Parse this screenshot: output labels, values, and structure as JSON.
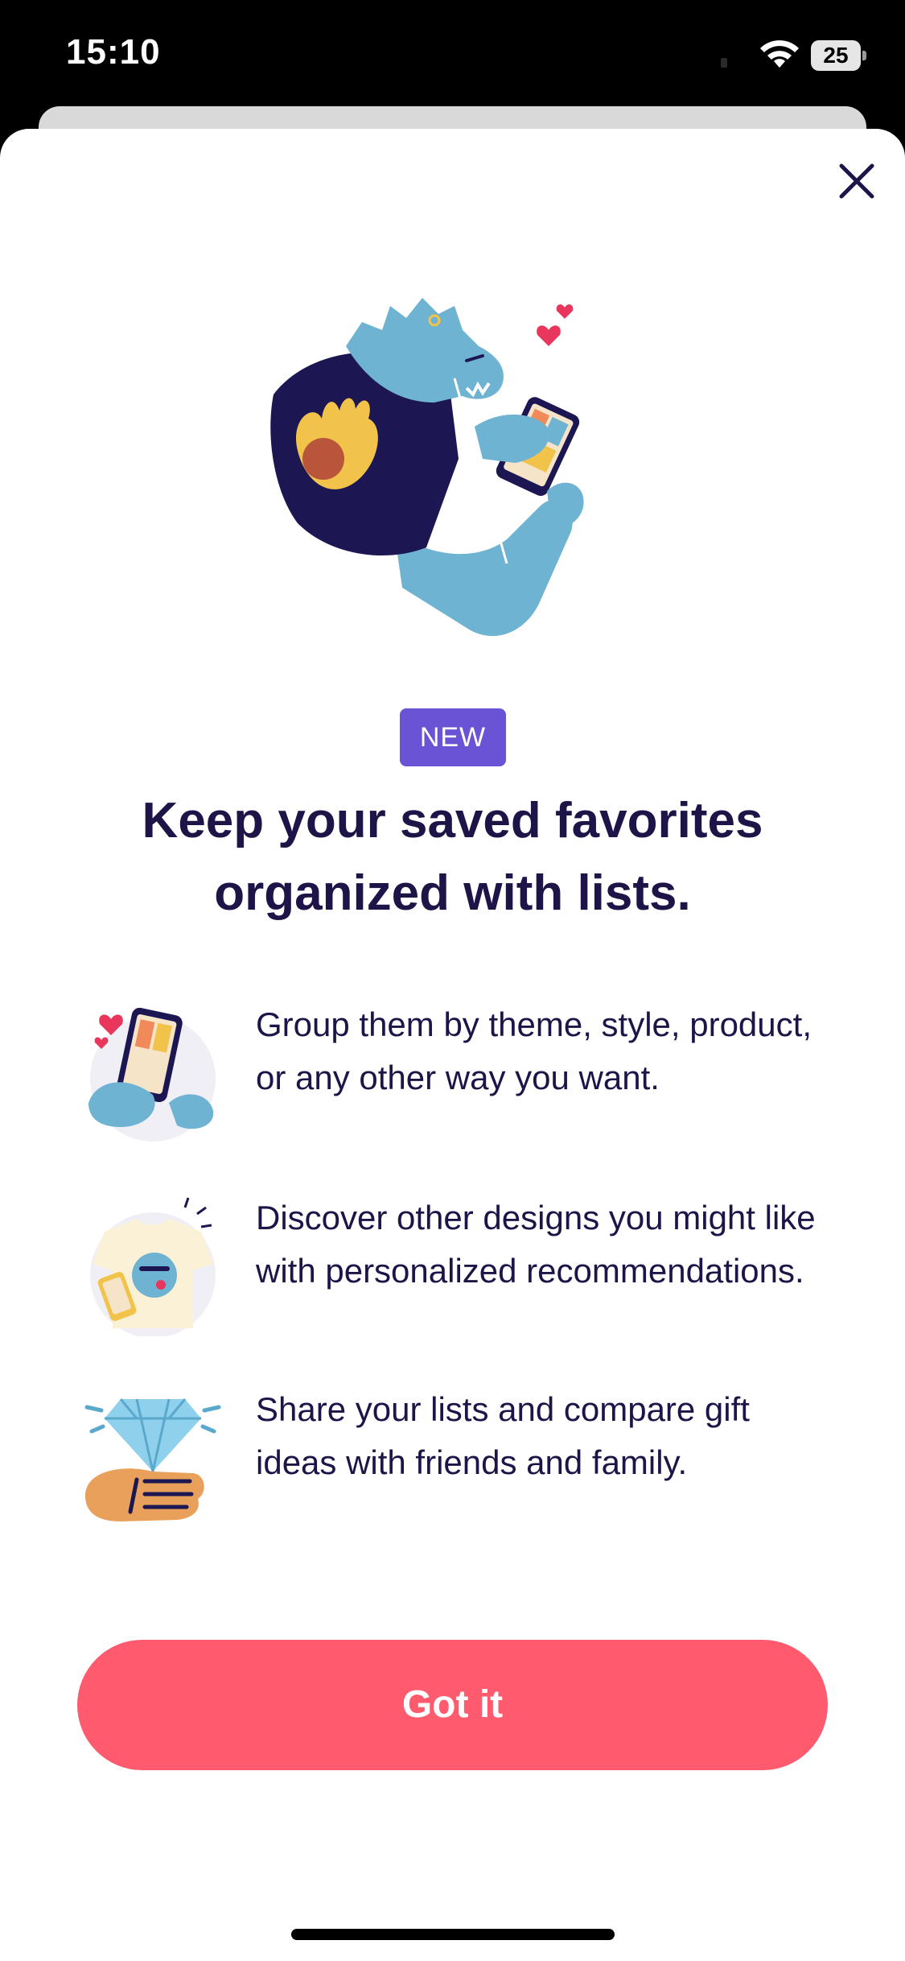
{
  "status_bar": {
    "time": "15:10",
    "battery_level": "25",
    "wifi_icon": "wifi-icon",
    "battery_icon": "battery-icon"
  },
  "sheet": {
    "close_icon": "close-icon",
    "hero_illustration": "monster-shopping-on-phone-illustration",
    "badge": "NEW",
    "title": "Keep your saved favorites organized with lists.",
    "features": [
      {
        "icon": "hands-holding-phone-illustration",
        "text": "Group them by theme, style, product, or any other way you want."
      },
      {
        "icon": "tshirt-with-monster-illustration",
        "text": "Discover other designs you might like with personalized recommendations."
      },
      {
        "icon": "diamond-gift-illustration",
        "text": "Share your lists and compare gift ideas with friends and family."
      }
    ],
    "primary_button": "Got it"
  },
  "colors": {
    "accent": "#ff5a6e",
    "badge": "#6b53d6",
    "text": "#1e1448",
    "monster": "#6fb3d3"
  }
}
